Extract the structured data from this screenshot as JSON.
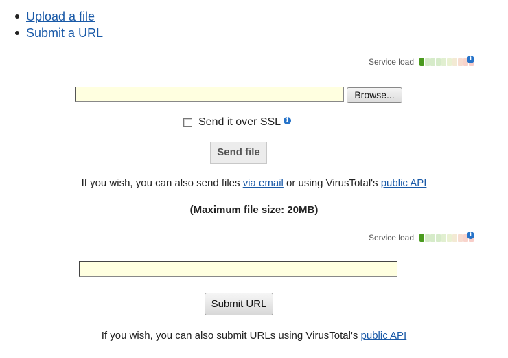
{
  "nav": {
    "items": [
      {
        "label": "Upload a file"
      },
      {
        "label": "Submit a URL"
      }
    ]
  },
  "file_section": {
    "service_load_label": "Service load",
    "browse_label": "Browse...",
    "ssl_label": "Send it over SSL",
    "send_label": "Send file",
    "info_text_prefix": "If you wish, you can also send files ",
    "via_email_link": "via email",
    "info_text_middle": " or using VirusTotal's ",
    "public_api_link": "public API",
    "max_size_text": "(Maximum file size: 20MB)"
  },
  "url_section": {
    "service_load_label": "Service load",
    "submit_label": "Submit URL",
    "info_text_prefix": "If you wish, you can also submit URLs using VirusTotal's ",
    "public_api_link": "public API"
  },
  "service_load": {
    "level": 1,
    "max": 10,
    "colors": [
      "#4a9a1e",
      "#d6ebc9",
      "#d6ebc9",
      "#d6ebc9",
      "#e1efd0",
      "#eaf1d2",
      "#f3ead4",
      "#f7dcd0",
      "#f8d4cc",
      "#f8cdc8"
    ]
  },
  "colors": {
    "link": "#1a5aa8",
    "input_bg": "#ffffe0",
    "info_icon": "#2673c9"
  },
  "icons": {
    "info": "info-icon",
    "bullet": "bullet-icon"
  }
}
